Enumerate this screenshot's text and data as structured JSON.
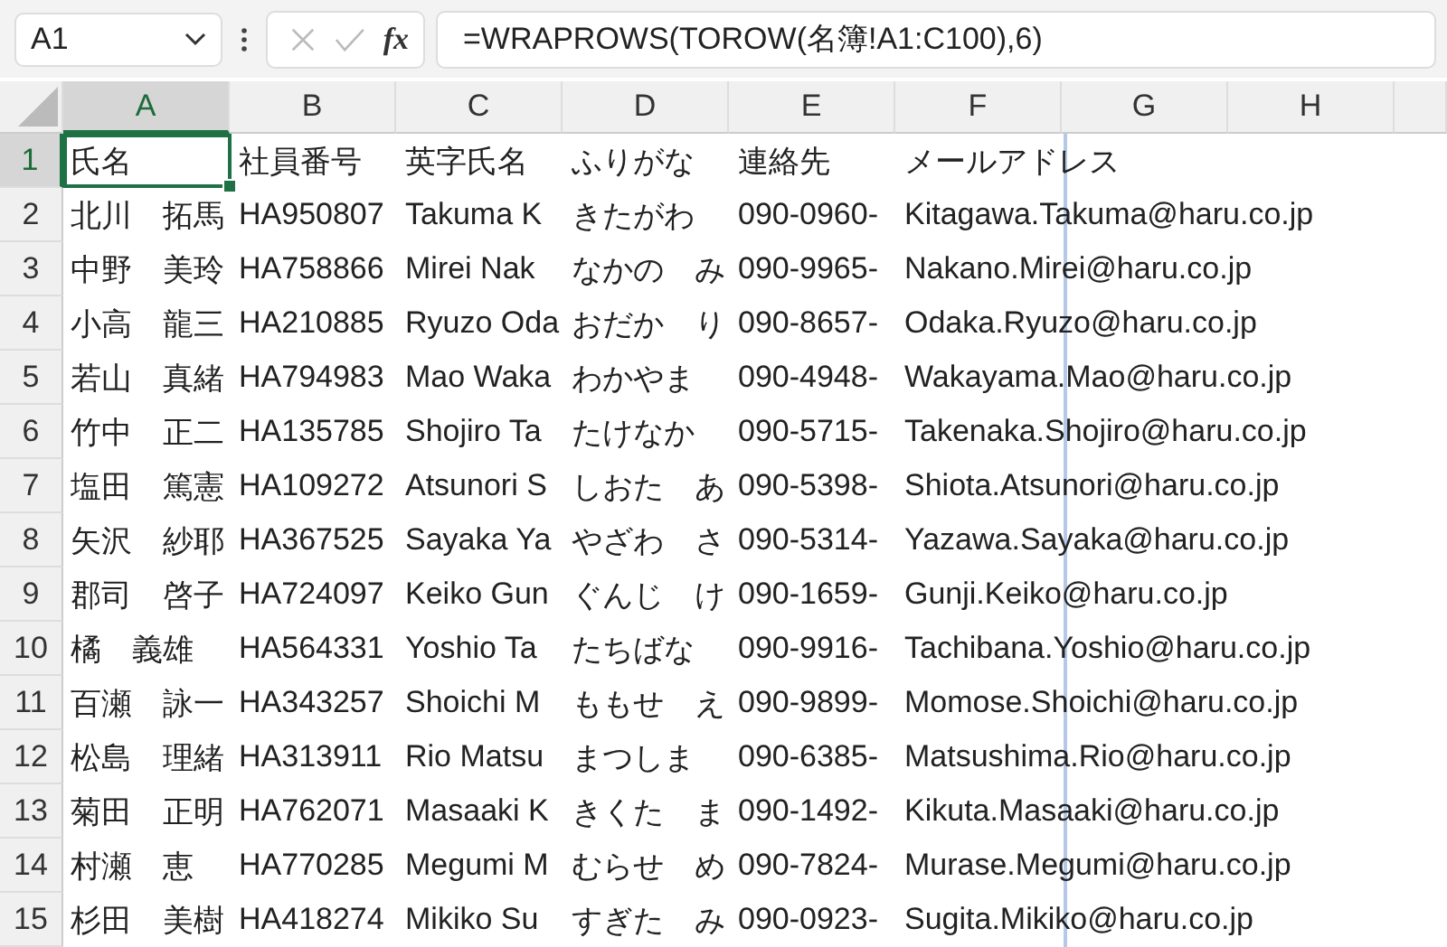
{
  "formula_bar": {
    "name_box": "A1",
    "function_button": "fx",
    "formula": "=WRAPROWS(TOROW(名簿!A1:C100),6)"
  },
  "columns": [
    {
      "label": "A",
      "selected": true
    },
    {
      "label": "B",
      "selected": false
    },
    {
      "label": "C",
      "selected": false
    },
    {
      "label": "D",
      "selected": false
    },
    {
      "label": "E",
      "selected": false
    },
    {
      "label": "F",
      "selected": false
    },
    {
      "label": "G",
      "selected": false
    },
    {
      "label": "H",
      "selected": false
    }
  ],
  "rows": [
    {
      "number": "1",
      "selected": true,
      "cells": [
        "氏名",
        "社員番号",
        "英字氏名",
        "ふりがな",
        "連絡先",
        "メールアドレス"
      ]
    },
    {
      "number": "2",
      "selected": false,
      "cells": [
        "北川　拓馬",
        "HA950807",
        "Takuma K",
        "きたがわ",
        "090-0960-",
        "Kitagawa.Takuma@haru.co.jp"
      ]
    },
    {
      "number": "3",
      "selected": false,
      "cells": [
        "中野　美玲",
        "HA758866",
        "Mirei Nak",
        "なかの　み",
        "090-9965-",
        "Nakano.Mirei@haru.co.jp"
      ]
    },
    {
      "number": "4",
      "selected": false,
      "cells": [
        "小高　龍三",
        "HA210885",
        "Ryuzo Oda",
        "おだか　り",
        "090-8657-",
        "Odaka.Ryuzo@haru.co.jp"
      ]
    },
    {
      "number": "5",
      "selected": false,
      "cells": [
        "若山　真緒",
        "HA794983",
        "Mao Waka",
        "わかやま",
        "090-4948-",
        "Wakayama.Mao@haru.co.jp"
      ]
    },
    {
      "number": "6",
      "selected": false,
      "cells": [
        "竹中　正二",
        "HA135785",
        "Shojiro Ta",
        "たけなか",
        "090-5715-",
        "Takenaka.Shojiro@haru.co.jp"
      ]
    },
    {
      "number": "7",
      "selected": false,
      "cells": [
        "塩田　篤憲",
        "HA109272",
        "Atsunori S",
        "しおた　あ",
        "090-5398-",
        "Shiota.Atsunori@haru.co.jp"
      ]
    },
    {
      "number": "8",
      "selected": false,
      "cells": [
        "矢沢　紗耶",
        "HA367525",
        "Sayaka Ya",
        "やざわ　さ",
        "090-5314-",
        "Yazawa.Sayaka@haru.co.jp"
      ]
    },
    {
      "number": "9",
      "selected": false,
      "cells": [
        "郡司　啓子",
        "HA724097",
        "Keiko Gun",
        "ぐんじ　け",
        "090-1659-",
        "Gunji.Keiko@haru.co.jp"
      ]
    },
    {
      "number": "10",
      "selected": false,
      "cells": [
        "橘　義雄",
        "HA564331",
        "Yoshio Ta",
        "たちばな",
        "090-9916-",
        "Tachibana.Yoshio@haru.co.jp"
      ]
    },
    {
      "number": "11",
      "selected": false,
      "cells": [
        "百瀬　詠一",
        "HA343257",
        "Shoichi M",
        "ももせ　え",
        "090-9899-",
        "Momose.Shoichi@haru.co.jp"
      ]
    },
    {
      "number": "12",
      "selected": false,
      "cells": [
        "松島　理緒",
        "HA313911",
        "Rio Matsu",
        "まつしま",
        "090-6385-",
        "Matsushima.Rio@haru.co.jp"
      ]
    },
    {
      "number": "13",
      "selected": false,
      "cells": [
        "菊田　正明",
        "HA762071",
        "Masaaki K",
        "きくた　ま",
        "090-1492-",
        "Kikuta.Masaaki@haru.co.jp"
      ]
    },
    {
      "number": "14",
      "selected": false,
      "cells": [
        "村瀬　恵",
        "HA770285",
        "Megumi M",
        "むらせ　め",
        "090-7824-",
        "Murase.Megumi@haru.co.jp"
      ]
    },
    {
      "number": "15",
      "selected": false,
      "cells": [
        "杉田　美樹",
        "HA418274",
        "Mikiko Su",
        "すぎた　み",
        "090-0923-",
        "Sugita.Mikiko@haru.co.jp"
      ]
    }
  ]
}
